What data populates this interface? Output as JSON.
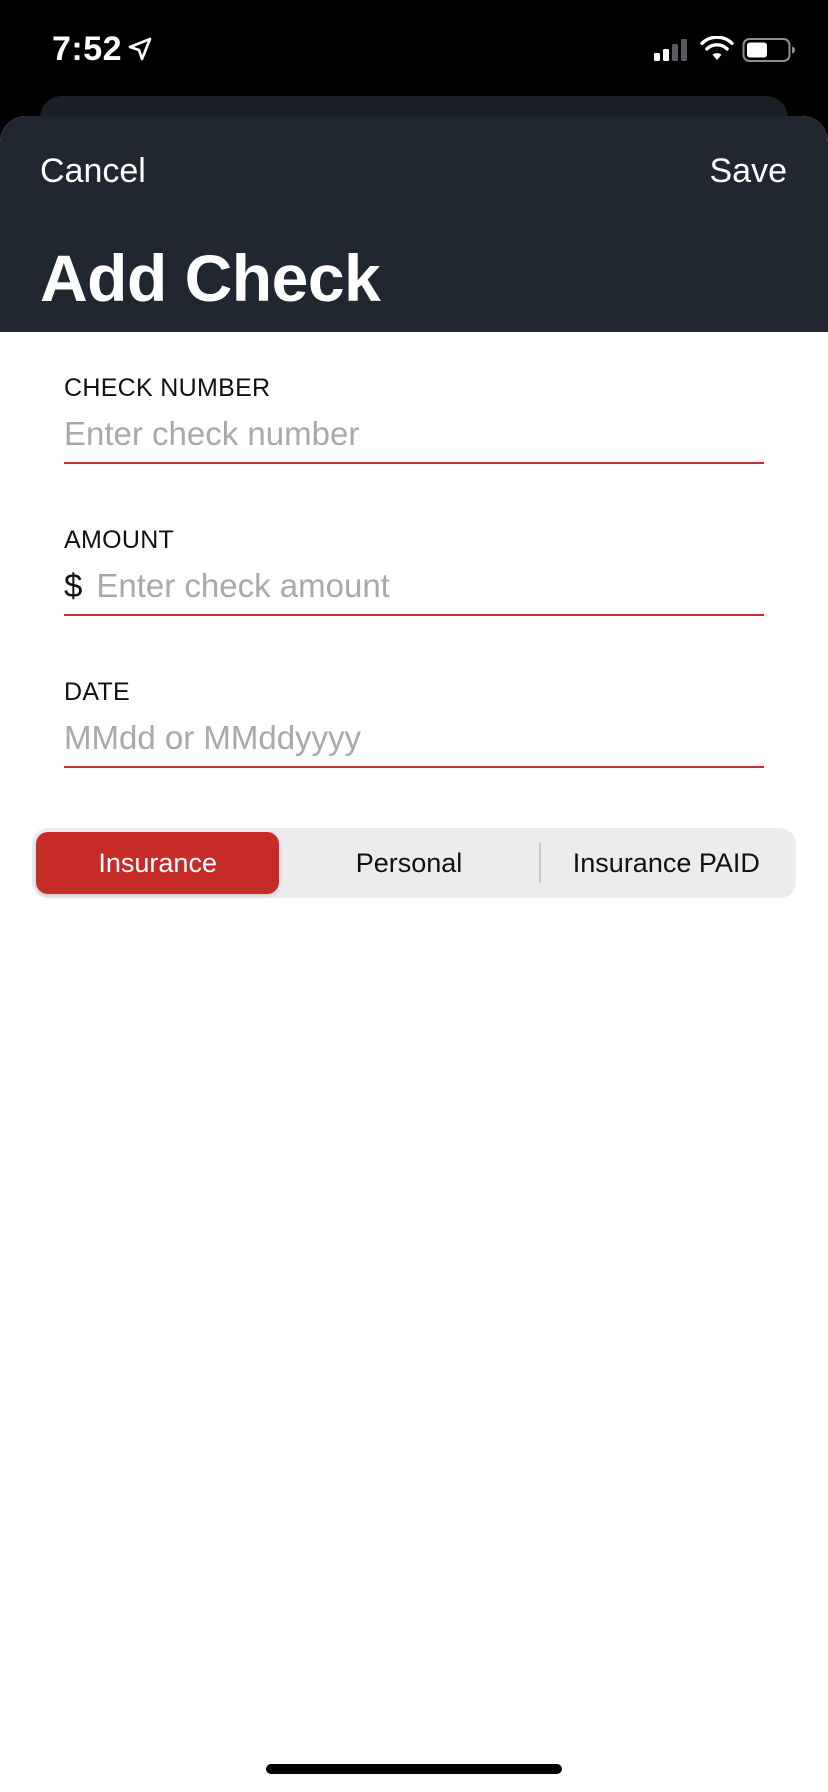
{
  "status_bar": {
    "time": "7:52"
  },
  "header": {
    "cancel_label": "Cancel",
    "save_label": "Save",
    "title": "Add Check"
  },
  "form": {
    "check_number": {
      "label": "CHECK NUMBER",
      "placeholder": "Enter check number",
      "value": ""
    },
    "amount": {
      "label": "AMOUNT",
      "currency": "$",
      "placeholder": "Enter check amount",
      "value": ""
    },
    "date": {
      "label": "DATE",
      "placeholder": "MMdd or MMddyyyy",
      "value": ""
    }
  },
  "check_type": {
    "options": [
      "Insurance",
      "Personal",
      "Insurance PAID"
    ],
    "selected": "Insurance"
  },
  "colors": {
    "accent": "#c52b27",
    "header_bg": "#212730",
    "underline": "#c9302c"
  },
  "icons": [
    "location-arrow-icon",
    "cellular-signal-icon",
    "wifi-icon",
    "battery-icon"
  ]
}
